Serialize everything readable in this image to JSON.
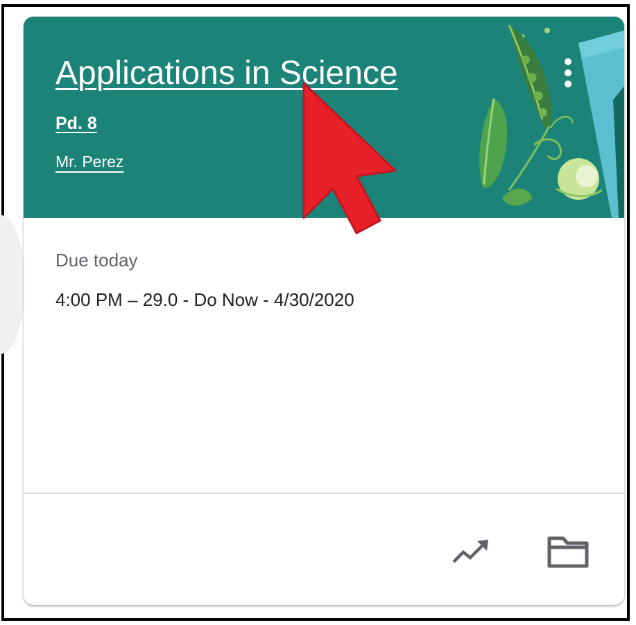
{
  "class_card": {
    "title": "Applications in Science",
    "section": "Pd. 8",
    "teacher": "Mr. Perez",
    "more_icon": "more-vert-icon",
    "header_color": "#1b8378"
  },
  "due": {
    "label": "Due today",
    "item": "4:00 PM – 29.0 - Do Now - 4/30/2020"
  },
  "footer": {
    "icons": [
      "trending-up-icon",
      "folder-icon"
    ]
  },
  "annotation": {
    "arrow_color": "#e8202a",
    "arrow_icon": "red-pointer-arrow-icon"
  }
}
